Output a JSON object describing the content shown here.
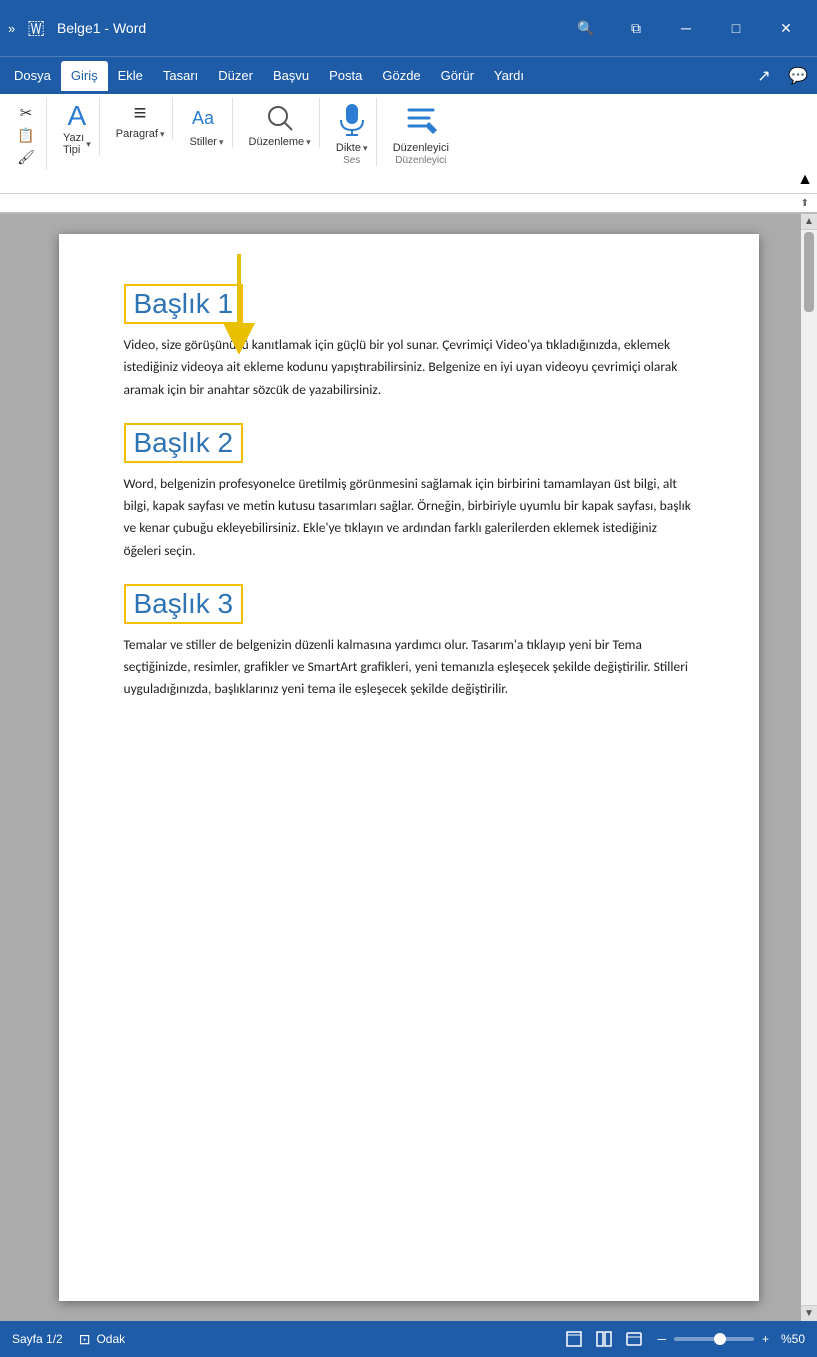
{
  "titlebar": {
    "quick_access": "»",
    "title": "Belge1 - Word",
    "search_icon": "🔍",
    "restore_icon": "⧉",
    "minimize_icon": "─",
    "maximize_icon": "□",
    "close_icon": "✕"
  },
  "menubar": {
    "items": [
      {
        "label": "Dosya",
        "active": false
      },
      {
        "label": "Giriş",
        "active": true
      },
      {
        "label": "Ekle",
        "active": false
      },
      {
        "label": "Tasarı",
        "active": false
      },
      {
        "label": "Düzer",
        "active": false
      },
      {
        "label": "Başvu",
        "active": false
      },
      {
        "label": "Posta",
        "active": false
      },
      {
        "label": "Gözde",
        "active": false
      },
      {
        "label": "Görür",
        "active": false
      },
      {
        "label": "Yardı",
        "active": false
      }
    ],
    "share_icon": "↗",
    "comment_icon": "💬"
  },
  "ribbon": {
    "groups": [
      {
        "name": "pano",
        "items": [
          {
            "label": "✂",
            "text": ""
          },
          {
            "label": "📋",
            "text": ""
          },
          {
            "label": "🖌",
            "text": ""
          }
        ]
      },
      {
        "name": "yazi_tipi",
        "label": "Yazı\nTipi",
        "arrow": "▾"
      },
      {
        "name": "paragraf",
        "label": "Paragraf",
        "arrow": "▾"
      },
      {
        "name": "stiller",
        "label": "Stiller",
        "arrow": "▾"
      },
      {
        "name": "duzenleme",
        "label": "Düzenleme",
        "arrow": "▾"
      },
      {
        "name": "dikte",
        "label": "Dikte",
        "sublabel": "Ses",
        "arrow": "▾"
      },
      {
        "name": "duzenleyici",
        "label": "Düzenleyici",
        "sublabel": "Düzenleyici"
      }
    ],
    "collapse_arrow": "▲"
  },
  "document": {
    "headings": [
      {
        "id": "baslik1",
        "text": "Başlık 1",
        "paragraph": "Video, size görüşünüzü kanıtlamak için güçlü bir yol sunar. Çevrimiçi Video'ya tıkladığınızda, eklemek istediğiniz videoya ait ekleme kodunu yapıştırabilirsiniz. Belgenize en iyi uyan videoyu çevrimiçi olarak aramak için bir anahtar sözcük de yazabilirsiniz."
      },
      {
        "id": "baslik2",
        "text": "Başlık 2",
        "paragraph": "Word, belgenizin profesyonelce üretilmiş görünmesini sağlamak için birbirini tamamlayan üst bilgi, alt bilgi, kapak sayfası ve metin kutusu tasarımları sağlar. Örneğin, birbiriyle uyumlu bir kapak sayfası, başlık ve kenar çubuğu ekleyebilirsiniz. Ekle'ye tıklayın ve ardından farklı galerilerden eklemek istediğiniz öğeleri seçin."
      },
      {
        "id": "baslik3",
        "text": "Başlık 3",
        "paragraph": "Temalar ve stiller de belgenizin düzenli kalmasına yardımcı olur. Tasarım'a tıklayıp yeni bir Tema seçtiğinizde, resimler, grafikler ve SmartArt grafikleri, yeni temanızla eşleşecek şekilde değiştirilir. Stilleri uyguladığınızda, başlıklarınız yeni tema ile eşleşecek şekilde değiştirilir."
      }
    ]
  },
  "statusbar": {
    "page_info": "Sayfa 1/2",
    "focus_icon": "⊡",
    "focus_label": "Odak",
    "view_icons": [
      "📄",
      "📋",
      "📊"
    ],
    "zoom_level": "%50",
    "zoom_minus": "─",
    "zoom_plus": "+"
  }
}
